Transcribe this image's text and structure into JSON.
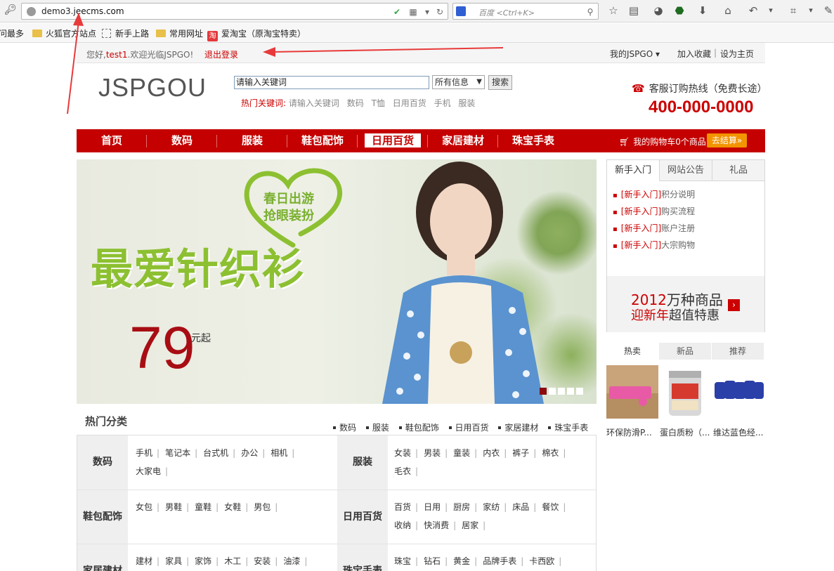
{
  "browser": {
    "url_host": "demo3.",
    "url_domain": "jeecms.com",
    "search_placeholder": "百度 <Ctrl+K>",
    "bookmarks": [
      "问最多",
      "火狐官方站点",
      "新手上路",
      "常用网址",
      "爱淘宝（原淘宝特卖）"
    ],
    "taobao_badge": "淘"
  },
  "topbar": {
    "greeting_prefix": "您好,",
    "username": "test1",
    "greeting_suffix": ".欢迎光临JSPGO!",
    "logout": "退出登录",
    "my_account": "我的JSPGO ▾",
    "add_favorite": "加入收藏",
    "separator": "|",
    "set_home": "设为主页"
  },
  "header": {
    "logo": "JSPGOU",
    "search_value": "请输入关键词",
    "search_scope": "所有信息",
    "search_button": "搜索",
    "hot_label": "热门关键词:",
    "hot_keywords": [
      "请输入关键词",
      "数码",
      "T恤",
      "日用百货",
      "手机",
      "服装"
    ],
    "hotline_title": "客服订购热线（免费长途）",
    "hotline_number": "400-000-0000"
  },
  "nav": {
    "items": [
      "首页",
      "数码",
      "服装",
      "鞋包配饰",
      "日用百货",
      "家居建材",
      "珠宝手表"
    ],
    "active_index": 4,
    "cart_text": "我的购物车0个商品",
    "checkout": "去结算»"
  },
  "banner": {
    "heart_line1": "春日出游",
    "heart_line2": "抢眼装扮",
    "title": "最爱针织衫",
    "price": "79",
    "price_unit": "元起",
    "slide_count": 5,
    "active_slide": 0
  },
  "side_panel": {
    "tabs": [
      "新手入门",
      "网站公告",
      "礼品"
    ],
    "active_tab": 0,
    "news_tag": "[新手入门]",
    "news": [
      "积分说明",
      "购买流程",
      "账户注册",
      "大宗购物"
    ],
    "promo_year": "2012",
    "promo_line1": "万种商品",
    "promo_line2_red": "迎新年",
    "promo_line2": "超值特惠"
  },
  "products": {
    "tabs": [
      "热卖",
      "新品",
      "推荐"
    ],
    "active_tab": 0,
    "items": [
      {
        "name": "环保防滑P..."
      },
      {
        "name": "蛋白质粉（..."
      },
      {
        "name": "维达蓝色经..."
      }
    ]
  },
  "categories": {
    "title": "热门分类",
    "links": [
      "数码",
      "服装",
      "鞋包配饰",
      "日用百货",
      "家居建材",
      "珠宝手表"
    ],
    "groups": [
      {
        "name": "数码",
        "items": [
          "手机",
          "笔记本",
          "台式机",
          "办公",
          "相机",
          "大家电"
        ]
      },
      {
        "name": "服装",
        "items": [
          "女装",
          "男装",
          "童装",
          "内衣",
          "裤子",
          "棉衣",
          "毛衣"
        ]
      },
      {
        "name": "鞋包配饰",
        "items": [
          "女包",
          "男鞋",
          "童鞋",
          "女鞋",
          "男包"
        ]
      },
      {
        "name": "日用百货",
        "items": [
          "百货",
          "日用",
          "厨房",
          "家纺",
          "床品",
          "餐饮",
          "收纳",
          "快消费",
          "居家"
        ]
      },
      {
        "name": "家居建材",
        "items": [
          "建材",
          "家具",
          "家饰",
          "木工",
          "安装",
          "油漆"
        ]
      },
      {
        "name": "珠宝手表",
        "items": [
          "珠宝",
          "钻石",
          "黄金",
          "品牌手表",
          "卡西欧"
        ]
      }
    ]
  },
  "colors": {
    "brand_red": "#c40000",
    "accent_orange": "#f29400",
    "banner_green": "#8cc031",
    "price_red": "#a80d14"
  }
}
